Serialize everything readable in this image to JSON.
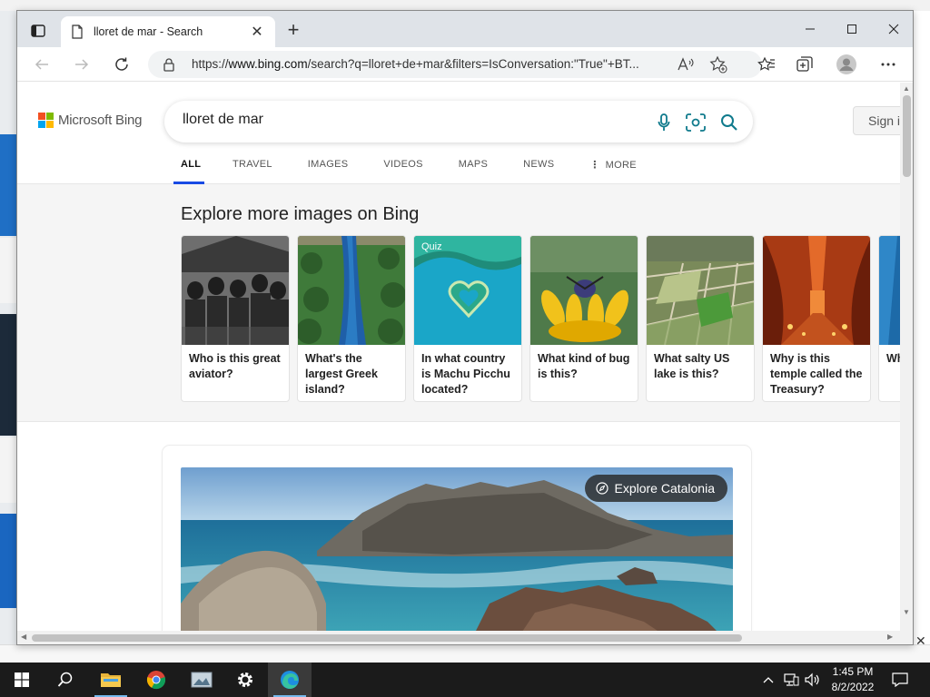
{
  "browser": {
    "tab_title": "lloret de mar - Search",
    "url_prefix": "https://",
    "url_host": "www.bing.com",
    "url_rest": "/search?q=lloret+de+mar&filters=IsConversation:\"True\"+BT..."
  },
  "bing": {
    "logo_text": "Microsoft Bing",
    "query": "lloret de mar",
    "signin_label": "Sign i",
    "nav_tabs": [
      "ALL",
      "TRAVEL",
      "IMAGES",
      "VIDEOS",
      "MAPS",
      "NEWS",
      "MORE"
    ],
    "explore_heading": "Explore more images on Bing",
    "cards": [
      {
        "caption": "Who is this great aviator?",
        "badge": ""
      },
      {
        "caption": "What's the largest Greek island?",
        "badge": ""
      },
      {
        "caption": "In what country is Machu Picchu located?",
        "badge": "Quiz"
      },
      {
        "caption": "What kind of bug is this?",
        "badge": ""
      },
      {
        "caption": "What salty US lake is this?",
        "badge": ""
      },
      {
        "caption": "Why is this temple called the Treasury?",
        "badge": ""
      },
      {
        "caption": "Wh",
        "badge": ""
      }
    ],
    "explore_pill": "Explore Catalonia"
  },
  "taskbar": {
    "time": "1:45 PM",
    "date": "8/2/2022"
  },
  "colors": {
    "bing_blue": "#174ae4",
    "search_icon": "#0f7a8c"
  }
}
